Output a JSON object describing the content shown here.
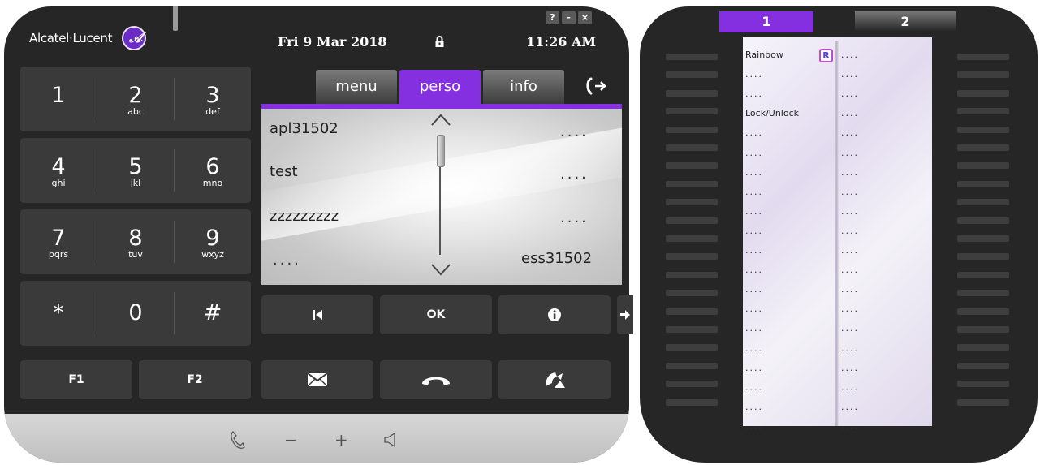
{
  "brand": {
    "name": "Alcatel·Lucent",
    "logo_glyph": "𝒜"
  },
  "window_buttons": {
    "help": "?",
    "minimize": "-",
    "close": "×"
  },
  "status": {
    "date": "Fri 9 Mar 2018",
    "time": "11:26 AM"
  },
  "keypad": [
    {
      "digit": "1",
      "letters": ""
    },
    {
      "digit": "2",
      "letters": "abc"
    },
    {
      "digit": "3",
      "letters": "def"
    },
    {
      "digit": "4",
      "letters": "ghi"
    },
    {
      "digit": "5",
      "letters": "jkl"
    },
    {
      "digit": "6",
      "letters": "mno"
    },
    {
      "digit": "7",
      "letters": "pqrs"
    },
    {
      "digit": "8",
      "letters": "tuv"
    },
    {
      "digit": "9",
      "letters": "wxyz"
    },
    {
      "digit": "*",
      "letters": ""
    },
    {
      "digit": "0",
      "letters": ""
    },
    {
      "digit": "#",
      "letters": ""
    }
  ],
  "function_keys": {
    "f1": "F1",
    "f2": "F2"
  },
  "tabs": {
    "menu": "menu",
    "perso": "perso",
    "info": "info",
    "active": "perso"
  },
  "perso_entries": {
    "left": [
      "apl31502",
      "test",
      "zzzzzzzzz",
      "...."
    ],
    "right": [
      "....",
      "....",
      "....",
      "ess31502"
    ]
  },
  "softkeys": {
    "back": "back",
    "ok": "OK",
    "info": "info",
    "forward": "forward"
  },
  "call_keys": {
    "message": "message",
    "hangup": "hangup",
    "redial": "redial"
  },
  "bottom_controls": {
    "minus": "−",
    "plus": "+"
  },
  "extension": {
    "tabs": [
      "1",
      "2"
    ],
    "active_tab": "1",
    "left_column": [
      "Rainbow",
      "....",
      "....",
      "Lock/Unlock",
      "....",
      "....",
      "....",
      "....",
      "....",
      "....",
      "....",
      "....",
      "....",
      "....",
      "....",
      "....",
      "....",
      "....",
      "....",
      "...."
    ],
    "right_column": [
      "....",
      "....",
      "....",
      "....",
      "....",
      "....",
      "....",
      "....",
      "....",
      "....",
      "....",
      "....",
      "....",
      "....",
      "....",
      "....",
      "....",
      "....",
      "....",
      "...."
    ],
    "rainbow_icon_letter": "R"
  },
  "colors": {
    "accent": "#8430e0",
    "body": "#262626",
    "key": "#3a3a3a"
  }
}
